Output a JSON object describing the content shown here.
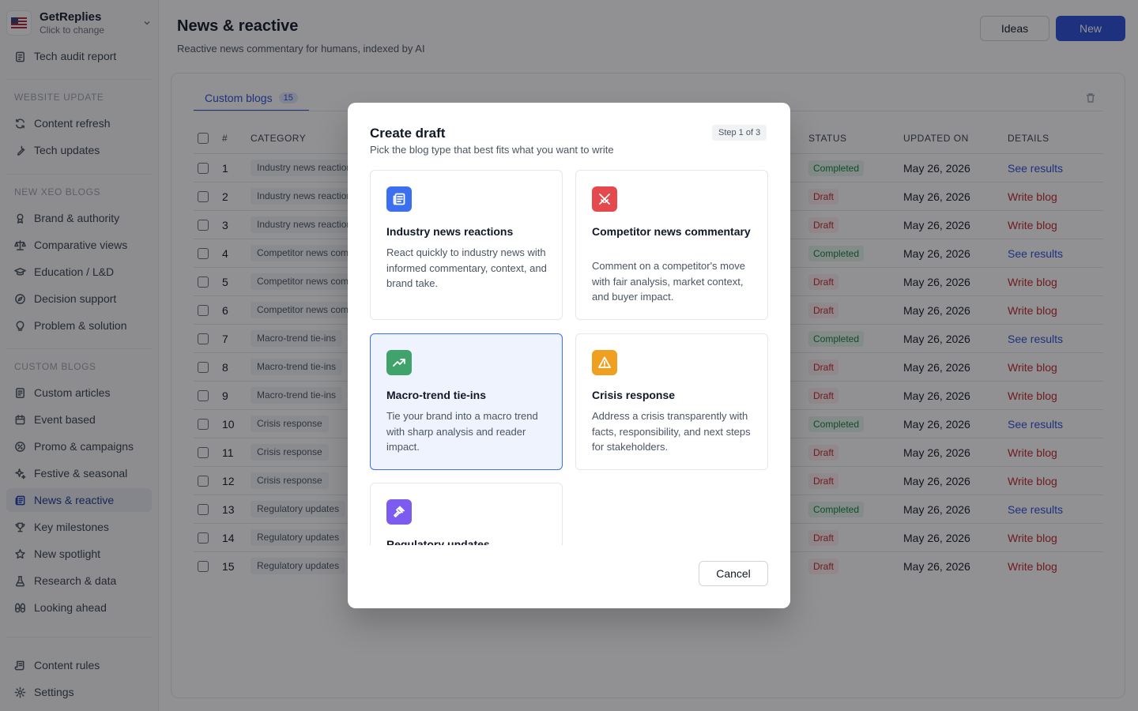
{
  "org": {
    "name": "GetReplies",
    "sub": "Click to change"
  },
  "sidebar": {
    "top_item": "Tech audit report",
    "sections": [
      {
        "label": "WEBSITE UPDATE",
        "items": [
          "Content refresh",
          "Tech updates"
        ]
      },
      {
        "label": "NEW XEO BLOGS",
        "items": [
          "Brand & authority",
          "Comparative views",
          "Education / L&D",
          "Decision support",
          "Problem & solution"
        ]
      },
      {
        "label": "CUSTOM BLOGS",
        "items": [
          "Custom articles",
          "Event based",
          "Promo & campaigns",
          "Festive & seasonal",
          "News & reactive",
          "Key milestones",
          "New spotlight",
          "Research & data",
          "Looking ahead"
        ]
      }
    ],
    "bottom_items": [
      "Content rules",
      "Settings"
    ],
    "active": "News & reactive"
  },
  "header": {
    "title": "News & reactive",
    "subtitle": "Reactive news commentary for humans, indexed by AI",
    "ideas_label": "Ideas",
    "new_label": "New"
  },
  "tabs": [
    {
      "label": "Custom blogs",
      "count": "15"
    }
  ],
  "table": {
    "headers": {
      "num": "#",
      "category": "CATEGORY",
      "status": "STATUS",
      "updated": "UPDATED ON",
      "details": "DETAILS"
    },
    "rows": [
      {
        "num": "1",
        "category": "Industry news reactions",
        "status": "Completed",
        "updated": "May 26, 2026",
        "detail": "See results"
      },
      {
        "num": "2",
        "category": "Industry news reactions",
        "status": "Draft",
        "updated": "May 26, 2026",
        "detail": "Write blog"
      },
      {
        "num": "3",
        "category": "Industry news reactions",
        "status": "Draft",
        "updated": "May 26, 2026",
        "detail": "Write blog"
      },
      {
        "num": "4",
        "category": "Competitor news commentary",
        "status": "Completed",
        "updated": "May 26, 2026",
        "detail": "See results"
      },
      {
        "num": "5",
        "category": "Competitor news commentary",
        "status": "Draft",
        "updated": "May 26, 2026",
        "detail": "Write blog"
      },
      {
        "num": "6",
        "category": "Competitor news commentary",
        "status": "Draft",
        "updated": "May 26, 2026",
        "detail": "Write blog"
      },
      {
        "num": "7",
        "category": "Macro-trend tie-ins",
        "status": "Completed",
        "updated": "May 26, 2026",
        "detail": "See results"
      },
      {
        "num": "8",
        "category": "Macro-trend tie-ins",
        "status": "Draft",
        "updated": "May 26, 2026",
        "detail": "Write blog"
      },
      {
        "num": "9",
        "category": "Macro-trend tie-ins",
        "status": "Draft",
        "updated": "May 26, 2026",
        "detail": "Write blog"
      },
      {
        "num": "10",
        "category": "Crisis response",
        "status": "Completed",
        "updated": "May 26, 2026",
        "detail": "See results"
      },
      {
        "num": "11",
        "category": "Crisis response",
        "status": "Draft",
        "updated": "May 26, 2026",
        "detail": "Write blog"
      },
      {
        "num": "12",
        "category": "Crisis response",
        "status": "Draft",
        "updated": "May 26, 2026",
        "detail": "Write blog"
      },
      {
        "num": "13",
        "category": "Regulatory updates",
        "status": "Completed",
        "updated": "May 26, 2026",
        "detail": "See results"
      },
      {
        "num": "14",
        "category": "Regulatory updates",
        "status": "Draft",
        "updated": "May 26, 2026",
        "detail": "Write blog"
      },
      {
        "num": "15",
        "category": "Regulatory updates",
        "status": "Draft",
        "updated": "May 26, 2026",
        "detail": "Write blog"
      }
    ]
  },
  "modal": {
    "title": "Create draft",
    "subtitle": "Pick the blog type that best fits what you want to write",
    "step": "Step 1 of 3",
    "cancel_label": "Cancel",
    "options": [
      {
        "title": "Industry news reactions",
        "desc": "React quickly to industry news with informed commentary, context, and brand take.",
        "icon": "newspaper-icon",
        "color": "#3b6ff0",
        "selected": false
      },
      {
        "title": "Competitor news commentary",
        "desc": "Comment on a competitor's move with fair analysis, market context, and buyer impact.",
        "icon": "swords-icon",
        "color": "#e5484d",
        "selected": false
      },
      {
        "title": "Macro-trend tie-ins",
        "desc": "Tie your brand into a macro trend with sharp analysis and reader impact.",
        "icon": "trending-up-icon",
        "color": "#3fa36b",
        "selected": true
      },
      {
        "title": "Crisis response",
        "desc": "Address a crisis transparently with facts, responsibility, and next steps for stakeholders.",
        "icon": "alert-triangle-icon",
        "color": "#f0a020",
        "selected": false
      },
      {
        "title": "Regulatory updates",
        "desc": "",
        "icon": "gavel-icon",
        "color": "#7c5cf0",
        "selected": false
      }
    ]
  }
}
